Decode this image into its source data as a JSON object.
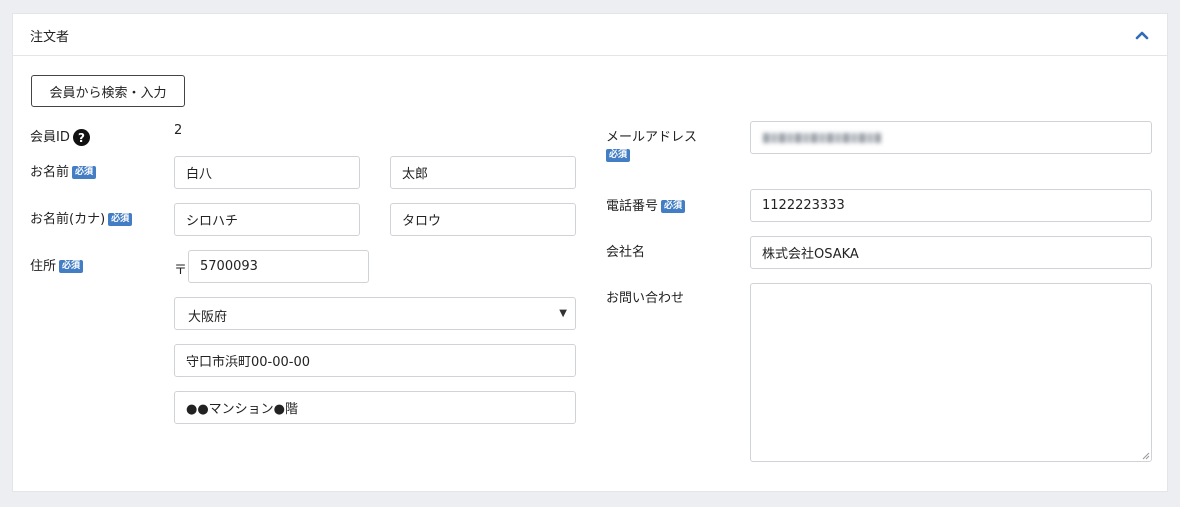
{
  "panel": {
    "title": "注文者"
  },
  "search_button_label": "会員から検索・入力",
  "left": {
    "member_id": {
      "label": "会員ID",
      "value": "2"
    },
    "name": {
      "label": "お名前",
      "badge": "必須",
      "last": "白八",
      "first": "太郎"
    },
    "kana": {
      "label": "お名前(カナ)",
      "badge": "必須",
      "last": "シロハチ",
      "first": "タロウ"
    },
    "address": {
      "label": "住所",
      "badge": "必須",
      "postal_mark": "〒",
      "postal_code": "5700093",
      "prefecture": "大阪府",
      "line1": "守口市浜町00-00-00",
      "line2": "●●マンション●階"
    }
  },
  "right": {
    "email": {
      "label": "メールアドレス",
      "badge": "必須"
    },
    "phone": {
      "label": "電話番号",
      "badge": "必須",
      "value": "1122223333"
    },
    "company": {
      "label": "会社名",
      "value": "株式会社OSAKA"
    },
    "inquiry": {
      "label": "お問い合わせ",
      "value": ""
    }
  },
  "colors": {
    "badge": "#437ec4",
    "accent": "#2f6db5"
  }
}
